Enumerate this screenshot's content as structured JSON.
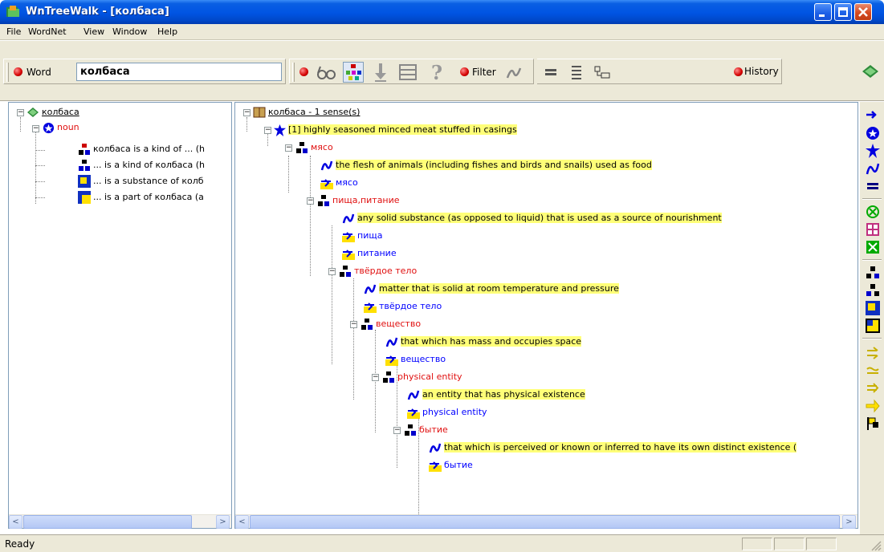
{
  "window": {
    "title": "WnTreeWalk - [колбаса]"
  },
  "menu": [
    "File",
    "WordNet",
    "View",
    "Window",
    "Help"
  ],
  "toolbar": {
    "word_label": "Word",
    "word_value": "колбаса",
    "filter_label": "Filter",
    "history_label": "History"
  },
  "left_tree": {
    "root": "колбаса",
    "pos": "noun",
    "relations": [
      "колбаса is a kind of ... (h",
      "... is a kind of колбаса (h",
      "... is a substance of колб",
      "... is a part of колбаса (a"
    ]
  },
  "right_tree": {
    "root": "колбаса - 1 sense(s)",
    "sense": "[1] highly seasoned minced meat stuffed in casings",
    "nodes": [
      {
        "head": "мясо",
        "gloss": "the flesh of animals (including fishes and birds and snails) used as food",
        "words": [
          "мясо"
        ]
      },
      {
        "head": "пища,питание",
        "gloss": "any solid substance (as opposed to liquid) that is used as a source of nourishment",
        "words": [
          "пища",
          "питание"
        ]
      },
      {
        "head": "твёрдое тело",
        "gloss": "matter that is solid at room temperature and pressure",
        "words": [
          "твёрдое тело"
        ]
      },
      {
        "head": "вещество",
        "gloss": "that which has mass and occupies space",
        "words": [
          "вещество"
        ]
      },
      {
        "head": "physical entity",
        "gloss": "an entity that has physical existence",
        "words": [
          "physical entity"
        ]
      },
      {
        "head": "бытие",
        "gloss": "that which is perceived or known or inferred to have its own distinct existence (",
        "words": [
          "бытие"
        ]
      }
    ]
  },
  "status": {
    "text": "Ready"
  }
}
